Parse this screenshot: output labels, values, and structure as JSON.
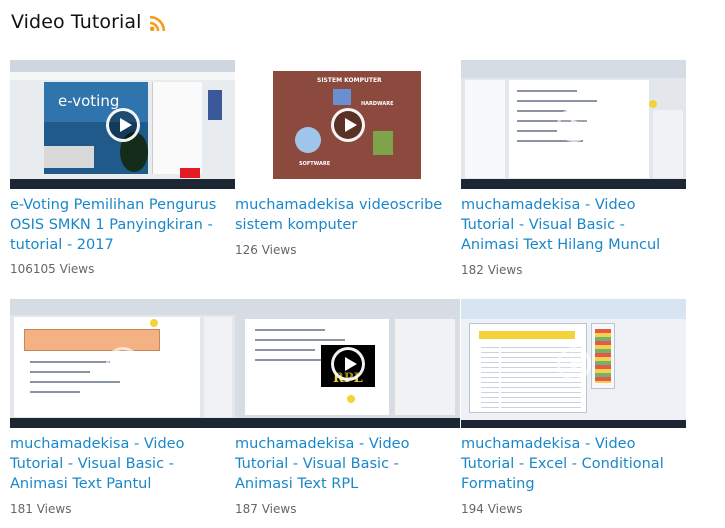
{
  "header": {
    "title": "Video Tutorial",
    "rss_icon": "rss-feed-icon"
  },
  "colors": {
    "link": "#1a87c8",
    "views": "#666666",
    "rss": "#f39a1d"
  },
  "videos": [
    {
      "title": "e-Voting Pemilihan Pengurus OSIS SMKN 1 Panyingkiran - tutorial - 2017",
      "views": "106105 Views"
    },
    {
      "title": "muchamadekisa videoscribe sistem komputer",
      "views": "126 Views"
    },
    {
      "title": "muchamadekisa - Video Tutorial - Visual Basic - Animasi Text Hilang Muncul",
      "views": "182 Views"
    },
    {
      "title": "muchamadekisa - Video Tutorial - Visual Basic - Animasi Text Pantul",
      "views": "181 Views"
    },
    {
      "title": "muchamadekisa - Video Tutorial - Visual Basic - Animasi Text RPL",
      "views": "187 Views"
    },
    {
      "title": "muchamadekisa - Video Tutorial - Excel - Conditional Formating",
      "views": "194 Views"
    }
  ],
  "thumb_text": {
    "evoting": "e-voting",
    "sk_title": "SISTEM KOMPUTER",
    "sk_hardware": "HARDWARE",
    "sk_software": "SOFTWARE",
    "rpl": "RPL"
  }
}
